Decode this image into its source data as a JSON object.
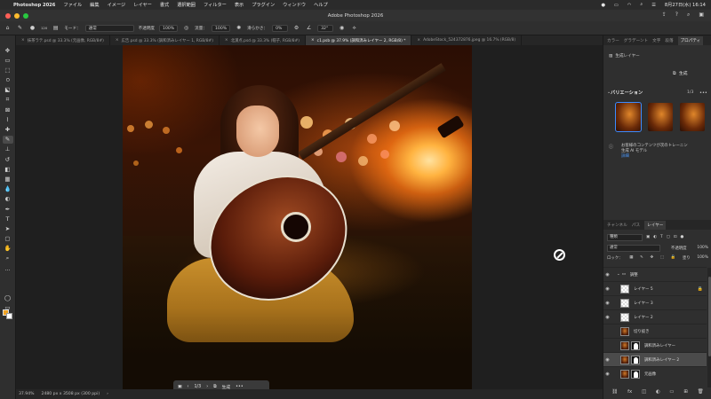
{
  "menubar": {
    "app_name": "Photoshop 2026",
    "items": [
      "ファイル",
      "編集",
      "イメージ",
      "レイヤー",
      "書式",
      "選択範囲",
      "フィルター",
      "表示",
      "プラグイン",
      "ウィンドウ",
      "ヘルプ"
    ],
    "date_time": "8月27日(水) 16:14"
  },
  "window": {
    "title": "Adobe Photoshop 2026"
  },
  "options_bar": {
    "mode_label": "モード：",
    "mode_value": "通常",
    "opacity_label": "不透明度",
    "opacity_value": "100%",
    "flow_label": "流量：",
    "flow_value": "100%",
    "smoothing_label": "滑らかさ：",
    "smoothing_value": "0%",
    "angle_value": "32°",
    "brush_size": "120"
  },
  "tabs": [
    {
      "label": "抹茶ラテ.psd @ 33.3% (元画像, RGB/8#)",
      "active": false
    },
    {
      "label": "広告.psd @ 33.3% (調和済みレイヤー 1, RGB/8#)",
      "active": false
    },
    {
      "label": "北漢点.psd @ 33.3% (帽子, RGB/8#)",
      "active": false
    },
    {
      "label": "c1.psb @ 37.9% (調和済みレイヤー 2, RGB/8) *",
      "active": true
    },
    {
      "label": "AdobeStock_524372876.jpeg @ 16.7% (RGB/8)",
      "active": false
    }
  ],
  "canvas_bar": {
    "page": "1/3",
    "generate_label": "生成"
  },
  "status": {
    "zoom": "37.94%",
    "doc_info": "2480 px x 3508 px (300 ppi)"
  },
  "properties_panel": {
    "tabs": [
      "カラー",
      "グラデーント",
      "文字",
      "段落",
      "プロパティ"
    ],
    "layer_name": "生成レイヤー",
    "generate_label": "生成",
    "variations_label": "バリエーション",
    "variations_count": "1/3",
    "disclaimer": "お客様のコンテンツが次のトレーニン",
    "model_label": "生成 AI モデル",
    "link_label": "詳細"
  },
  "layers_panel": {
    "tabs": [
      "チャンネル",
      "パス",
      "レイヤー"
    ],
    "filter_value": "種類",
    "blend_value": "通常",
    "opacity_label": "不透明度",
    "opacity_value": "100%",
    "lock_label": "ロック：",
    "fill_label": "塗り",
    "fill_value": "100%",
    "layers": [
      {
        "name": "調整",
        "type": "group",
        "active": false
      },
      {
        "name": "レイヤー 5",
        "type": "blank",
        "active": false,
        "locked": true
      },
      {
        "name": "レイヤー 3",
        "type": "blank",
        "active": false
      },
      {
        "name": "レイヤー 2",
        "type": "blank",
        "active": false
      },
      {
        "name": "切り抜き",
        "type": "photo",
        "active": false
      },
      {
        "name": "調和済みレイヤー",
        "type": "photo-mask",
        "active": false
      },
      {
        "name": "調和済みレイヤー 2",
        "type": "photo-mask",
        "active": true
      },
      {
        "name": "元画像",
        "type": "photo-mask",
        "active": false
      }
    ]
  }
}
